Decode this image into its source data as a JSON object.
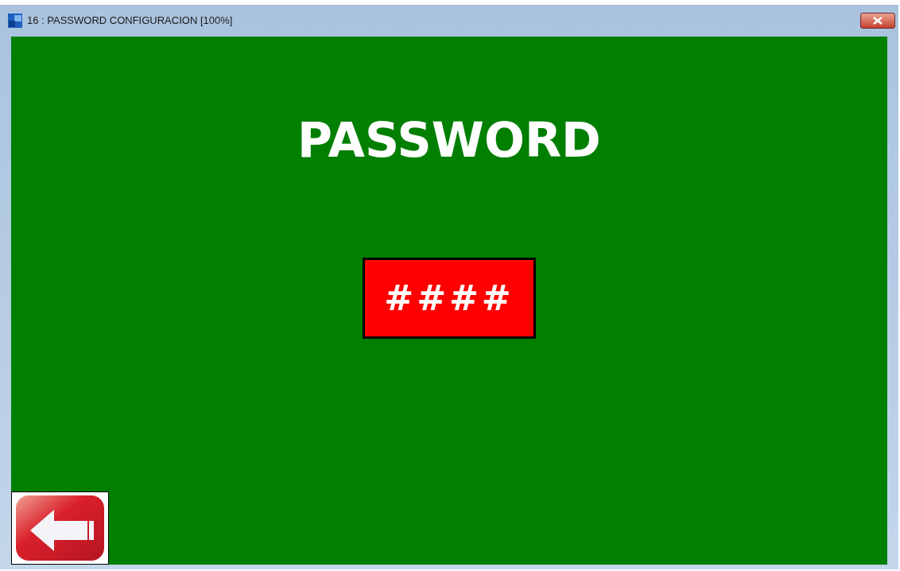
{
  "window": {
    "title": "16 : PASSWORD CONFIGURACION [100%]"
  },
  "heading": "PASSWORD",
  "password_field": {
    "value": "####"
  }
}
